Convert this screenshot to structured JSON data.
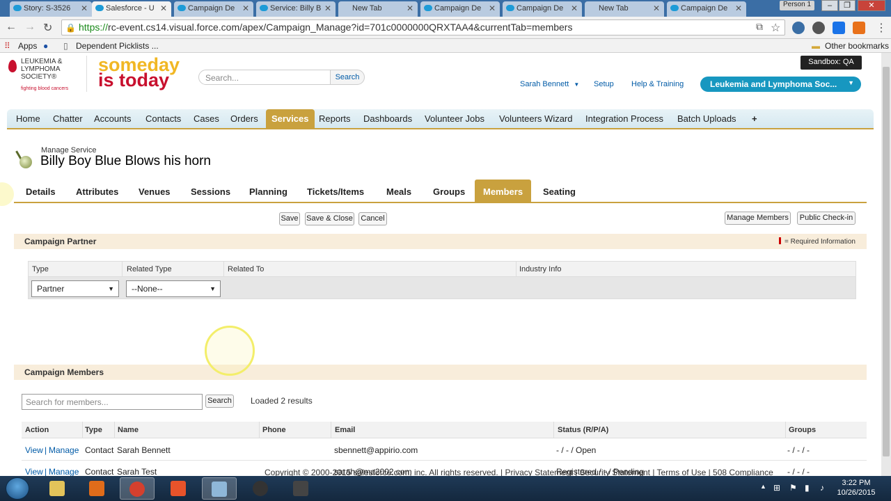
{
  "browser": {
    "tabs": [
      {
        "label": "Story: S-3526",
        "active": false
      },
      {
        "label": "Salesforce - U",
        "active": true
      },
      {
        "label": "Campaign De",
        "active": false
      },
      {
        "label": "Service: Billy B",
        "active": false
      },
      {
        "label": "New Tab",
        "active": false
      },
      {
        "label": "Campaign De",
        "active": false
      },
      {
        "label": "Campaign De",
        "active": false
      },
      {
        "label": "New Tab",
        "active": false
      },
      {
        "label": "Campaign De",
        "active": false
      }
    ],
    "profile": "Person 1",
    "url_scheme": "https://",
    "url_rest": "rc-event.cs14.visual.force.com/apex/Campaign_Manage?id=701c0000000QRXTAA4&currentTab=members",
    "bookmarks": {
      "apps": "Apps",
      "dependent": "Dependent Picklists ...",
      "other": "Other bookmarks"
    }
  },
  "header": {
    "lls_lines": [
      "LEUKEMIA &",
      "LYMPHOMA",
      "SOCIETY®"
    ],
    "lls_tag": "fighting blood cancers",
    "someday1": "someday",
    "someday2": "is today",
    "search_placeholder": "Search...",
    "search_button": "Search",
    "user": "Sarah Bennett",
    "setup": "Setup",
    "help": "Help & Training",
    "sandbox": "Sandbox:  QA",
    "app_menu": "Leukemia and Lymphoma Soc..."
  },
  "nav": {
    "items": [
      "Home",
      "Chatter",
      "Accounts",
      "Contacts",
      "Cases",
      "Orders",
      "Services",
      "Reports",
      "Dashboards",
      "Volunteer Jobs",
      "Volunteers Wizard",
      "Integration Process",
      "Batch Uploads",
      "+"
    ],
    "active": "Services"
  },
  "service": {
    "subtitle": "Manage Service",
    "title": "Billy Boy Blue Blows his horn"
  },
  "subtabs": {
    "items": [
      "Details",
      "Attributes",
      "Venues",
      "Sessions",
      "Planning",
      "Tickets/Items",
      "Meals",
      "Groups",
      "Members",
      "Seating"
    ],
    "active": "Members"
  },
  "buttons": {
    "save": "Save",
    "save_close": "Save & Close",
    "cancel": "Cancel",
    "manage_members": "Manage Members",
    "public_checkin": "Public Check-in"
  },
  "partner": {
    "heading": "Campaign Partner",
    "required": "= Required Information",
    "columns": [
      "Type",
      "Related Type",
      "Related To",
      "Industry Info"
    ],
    "type_value": "Partner",
    "related_type_value": "--None--"
  },
  "members": {
    "heading": "Campaign Members",
    "search_placeholder": "Search for members...",
    "search_button": "Search",
    "loaded": "Loaded 2 results",
    "columns": [
      "Action",
      "Type",
      "Name",
      "Phone",
      "Email",
      "Status (R/P/A)",
      "Groups"
    ],
    "rows": [
      {
        "view": "View",
        "manage": "Manage",
        "type": "Contact",
        "name": "Sarah Bennett",
        "phone": "",
        "email": "sbennett@appirio.com",
        "status": "- / - / Open",
        "groups": "- / - / -"
      },
      {
        "view": "View",
        "manage": "Manage",
        "type": "Contact",
        "name": "Sarah Test",
        "phone": "",
        "email": "sarah@ma2002.com",
        "status": "Registered / - / Pending",
        "groups": "- / - / -"
      }
    ]
  },
  "footer": "Copyright © 2000-2015 salesforce.com, inc. All rights reserved. | Privacy Statement | Security Statement | Terms of Use | 508 Compliance",
  "taskbar": {
    "time": "3:22 PM",
    "date": "10/26/2015"
  },
  "colors": {
    "gold": "#c9a13e",
    "link": "#015ba7",
    "app": "#1797c0"
  }
}
